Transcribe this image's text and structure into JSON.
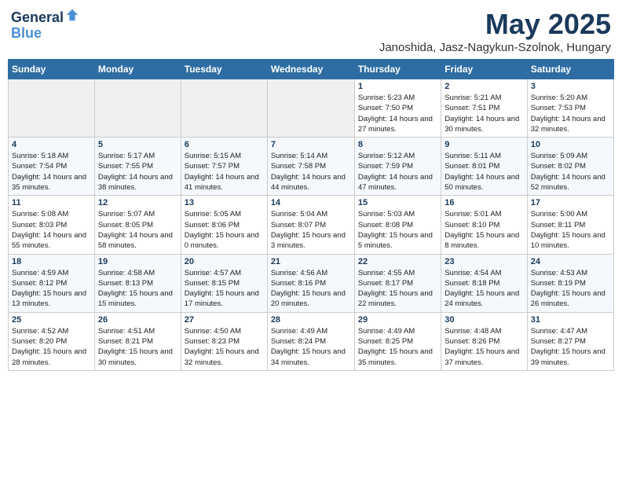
{
  "header": {
    "logo_line1": "General",
    "logo_line2": "Blue",
    "month_title": "May 2025",
    "location": "Janoshida, Jasz-Nagykun-Szolnok, Hungary"
  },
  "calendar": {
    "days_of_week": [
      "Sunday",
      "Monday",
      "Tuesday",
      "Wednesday",
      "Thursday",
      "Friday",
      "Saturday"
    ],
    "weeks": [
      [
        {
          "day": "",
          "empty": true
        },
        {
          "day": "",
          "empty": true
        },
        {
          "day": "",
          "empty": true
        },
        {
          "day": "",
          "empty": true
        },
        {
          "day": "1",
          "sunrise": "5:23 AM",
          "sunset": "7:50 PM",
          "daylight": "14 hours and 27 minutes."
        },
        {
          "day": "2",
          "sunrise": "5:21 AM",
          "sunset": "7:51 PM",
          "daylight": "14 hours and 30 minutes."
        },
        {
          "day": "3",
          "sunrise": "5:20 AM",
          "sunset": "7:53 PM",
          "daylight": "14 hours and 32 minutes."
        }
      ],
      [
        {
          "day": "4",
          "sunrise": "5:18 AM",
          "sunset": "7:54 PM",
          "daylight": "14 hours and 35 minutes."
        },
        {
          "day": "5",
          "sunrise": "5:17 AM",
          "sunset": "7:55 PM",
          "daylight": "14 hours and 38 minutes."
        },
        {
          "day": "6",
          "sunrise": "5:15 AM",
          "sunset": "7:57 PM",
          "daylight": "14 hours and 41 minutes."
        },
        {
          "day": "7",
          "sunrise": "5:14 AM",
          "sunset": "7:58 PM",
          "daylight": "14 hours and 44 minutes."
        },
        {
          "day": "8",
          "sunrise": "5:12 AM",
          "sunset": "7:59 PM",
          "daylight": "14 hours and 47 minutes."
        },
        {
          "day": "9",
          "sunrise": "5:11 AM",
          "sunset": "8:01 PM",
          "daylight": "14 hours and 50 minutes."
        },
        {
          "day": "10",
          "sunrise": "5:09 AM",
          "sunset": "8:02 PM",
          "daylight": "14 hours and 52 minutes."
        }
      ],
      [
        {
          "day": "11",
          "sunrise": "5:08 AM",
          "sunset": "8:03 PM",
          "daylight": "14 hours and 55 minutes."
        },
        {
          "day": "12",
          "sunrise": "5:07 AM",
          "sunset": "8:05 PM",
          "daylight": "14 hours and 58 minutes."
        },
        {
          "day": "13",
          "sunrise": "5:05 AM",
          "sunset": "8:06 PM",
          "daylight": "15 hours and 0 minutes."
        },
        {
          "day": "14",
          "sunrise": "5:04 AM",
          "sunset": "8:07 PM",
          "daylight": "15 hours and 3 minutes."
        },
        {
          "day": "15",
          "sunrise": "5:03 AM",
          "sunset": "8:08 PM",
          "daylight": "15 hours and 5 minutes."
        },
        {
          "day": "16",
          "sunrise": "5:01 AM",
          "sunset": "8:10 PM",
          "daylight": "15 hours and 8 minutes."
        },
        {
          "day": "17",
          "sunrise": "5:00 AM",
          "sunset": "8:11 PM",
          "daylight": "15 hours and 10 minutes."
        }
      ],
      [
        {
          "day": "18",
          "sunrise": "4:59 AM",
          "sunset": "8:12 PM",
          "daylight": "15 hours and 13 minutes."
        },
        {
          "day": "19",
          "sunrise": "4:58 AM",
          "sunset": "8:13 PM",
          "daylight": "15 hours and 15 minutes."
        },
        {
          "day": "20",
          "sunrise": "4:57 AM",
          "sunset": "8:15 PM",
          "daylight": "15 hours and 17 minutes."
        },
        {
          "day": "21",
          "sunrise": "4:56 AM",
          "sunset": "8:16 PM",
          "daylight": "15 hours and 20 minutes."
        },
        {
          "day": "22",
          "sunrise": "4:55 AM",
          "sunset": "8:17 PM",
          "daylight": "15 hours and 22 minutes."
        },
        {
          "day": "23",
          "sunrise": "4:54 AM",
          "sunset": "8:18 PM",
          "daylight": "15 hours and 24 minutes."
        },
        {
          "day": "24",
          "sunrise": "4:53 AM",
          "sunset": "8:19 PM",
          "daylight": "15 hours and 26 minutes."
        }
      ],
      [
        {
          "day": "25",
          "sunrise": "4:52 AM",
          "sunset": "8:20 PM",
          "daylight": "15 hours and 28 minutes."
        },
        {
          "day": "26",
          "sunrise": "4:51 AM",
          "sunset": "8:21 PM",
          "daylight": "15 hours and 30 minutes."
        },
        {
          "day": "27",
          "sunrise": "4:50 AM",
          "sunset": "8:23 PM",
          "daylight": "15 hours and 32 minutes."
        },
        {
          "day": "28",
          "sunrise": "4:49 AM",
          "sunset": "8:24 PM",
          "daylight": "15 hours and 34 minutes."
        },
        {
          "day": "29",
          "sunrise": "4:49 AM",
          "sunset": "8:25 PM",
          "daylight": "15 hours and 35 minutes."
        },
        {
          "day": "30",
          "sunrise": "4:48 AM",
          "sunset": "8:26 PM",
          "daylight": "15 hours and 37 minutes."
        },
        {
          "day": "31",
          "sunrise": "4:47 AM",
          "sunset": "8:27 PM",
          "daylight": "15 hours and 39 minutes."
        }
      ]
    ]
  }
}
